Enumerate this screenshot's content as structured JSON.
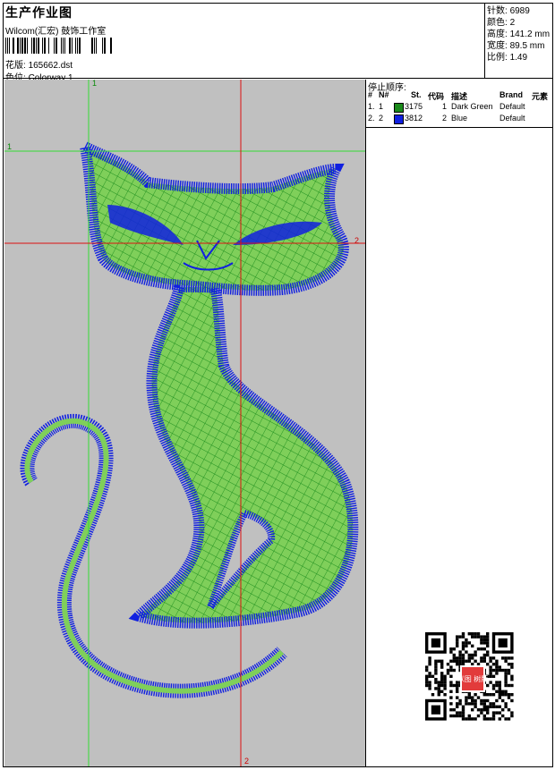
{
  "header": {
    "title": "生产作业图",
    "company": "Wilcom(汇宏) 鼓饰工作室",
    "pattern_label": "花版:",
    "pattern_value": "165662.dst",
    "colorway_label": "色位:",
    "colorway_value": "Colorway 1"
  },
  "stats": {
    "stitches_label": "针数:",
    "stitches_value": "6989",
    "colors_label": "颜色:",
    "colors_value": "2",
    "height_label": "高度:",
    "height_value": "141.2 mm",
    "width_label": "宽度:",
    "width_value": "89.5 mm",
    "scale_label": "比例:",
    "scale_value": "1.49"
  },
  "stop_sequence": {
    "title": "停止顺序:",
    "columns": {
      "hash": "#",
      "n": "N#",
      "st": "St.",
      "code": "代码",
      "desc": "描述",
      "brand": "Brand",
      "elements": "元素"
    },
    "rows": [
      {
        "num": "1.",
        "n": "1",
        "st": "3175",
        "code": "1",
        "desc": "Dark Green",
        "brand": "Default",
        "color": "#1a8a1a"
      },
      {
        "num": "2.",
        "n": "2",
        "st": "3812",
        "code": "2",
        "desc": "Blue",
        "brand": "Default",
        "color": "#1020e0"
      }
    ]
  },
  "guides": {
    "green_v": "1",
    "green_h": "1",
    "red_h": "2",
    "red_v": "2"
  },
  "qr": {
    "stamp_text": "以图 树版"
  },
  "colors": {
    "canvas_bg": "#c0c0c0",
    "stitch_green": "#22aa22",
    "fill_green": "#7fcf5a",
    "stitch_blue": "#1020e0",
    "guide_green": "#33dd33",
    "guide_red": "#dd1111"
  }
}
